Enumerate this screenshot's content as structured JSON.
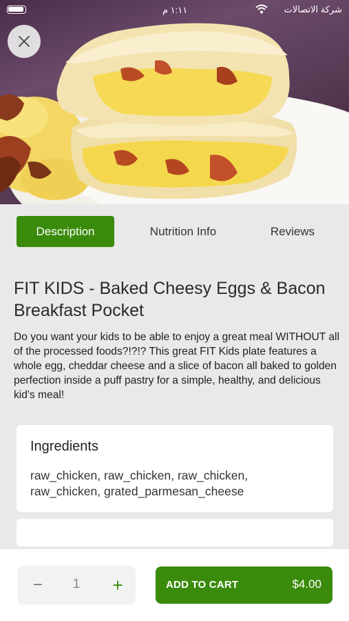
{
  "status_bar": {
    "time": "١:١١ م",
    "carrier": "شركة الاتصالات"
  },
  "hero": {
    "image_description": "baked cheesy egg and bacon breakfast pocket"
  },
  "tabs": [
    {
      "label": "Description",
      "active": true
    },
    {
      "label": "Nutrition Info",
      "active": false
    },
    {
      "label": "Reviews",
      "active": false
    }
  ],
  "product": {
    "title": "FIT KIDS - Baked Cheesy Eggs & Bacon Breakfast Pocket",
    "description": "Do you want your kids to be able to enjoy a great meal WITHOUT all of the processed foods?!?!? This great FIT Kids plate features a whole egg, cheddar cheese and a slice of bacon all baked to golden perfection inside a puff pastry for a simple, healthy, and delicious kid's meal!"
  },
  "ingredients": {
    "heading": "Ingredients",
    "text": "raw_chicken, raw_chicken, raw_chicken, raw_chicken, grated_parmesan_cheese"
  },
  "cart": {
    "minus": "−",
    "quantity": "1",
    "plus": "+",
    "add_label": "ADD TO CART",
    "price": "$4.00"
  },
  "colors": {
    "accent": "#3a8b0c",
    "page_bg": "#e9e9e9"
  }
}
